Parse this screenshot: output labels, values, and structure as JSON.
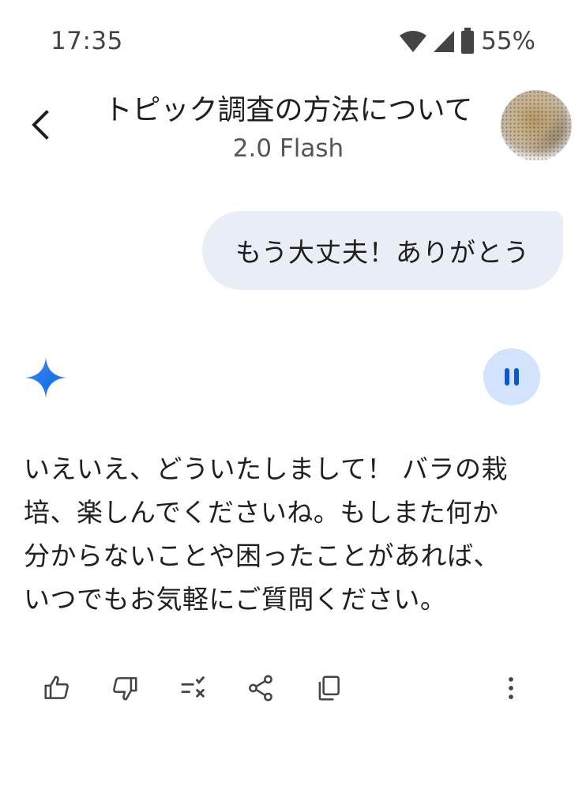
{
  "status_bar": {
    "time": "17:35",
    "battery": "55%"
  },
  "header": {
    "title": "トピック調査の方法について",
    "subtitle": "2.0 Flash"
  },
  "conversation": {
    "user_message": "もう大丈夫！ありがとう",
    "response_lines": [
      "いえいえ、どういたしまして！ バラの栽",
      "培、楽しんでくださいね。もしまた何か",
      "分からないことや困ったことがあれば、",
      "いつでもお気軽にご質問ください。"
    ]
  },
  "actions": {
    "icons": [
      "thumbs-up-icon",
      "thumbs-down-icon",
      "modify-response-icon",
      "share-icon",
      "copy-icon",
      "more-vert-icon"
    ]
  },
  "colors": {
    "accent_blue": "#1a73e8",
    "bubble_bg": "#e9eef6",
    "pause_bg": "#d3e3fd",
    "pause_icon": "#0b57d0"
  }
}
